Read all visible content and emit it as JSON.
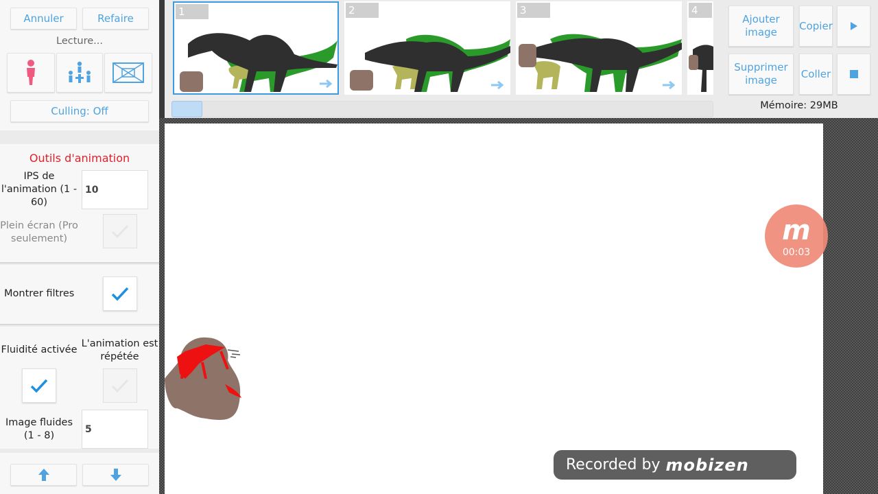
{
  "toolbar": {
    "undo_label": "Annuler",
    "redo_label": "Refaire",
    "play_label": "Lecture...",
    "culling_label": "Culling: Off"
  },
  "animation_tools": {
    "title": "Outils d'animation",
    "fps_label": "IPS de l'animation (1 - 60)",
    "fps_value": "10",
    "fullscreen_label": "Plein écran (Pro seulement)",
    "fullscreen_checked": false,
    "show_filters_label": "Montrer filtres",
    "show_filters_checked": true,
    "smoothing_label": "Fluidité activée",
    "smoothing_checked": true,
    "loop_label": "L'animation est répétée",
    "loop_checked": false,
    "smooth_frames_label": "Image fluides (1 - 8)",
    "smooth_frames_value": "5"
  },
  "frames": [
    {
      "number": "1",
      "selected": true
    },
    {
      "number": "2",
      "selected": false
    },
    {
      "number": "3",
      "selected": false
    },
    {
      "number": "4",
      "selected": false
    }
  ],
  "frame_actions": {
    "add_label": "Ajouter image",
    "copy_label": "Copier",
    "delete_label": "Supprimer image",
    "paste_label": "Coller",
    "memory_label": "Mémoire: 29MB"
  },
  "recorder": {
    "badge_letter": "m",
    "timer": "00:03",
    "recorded_by": "Recorded by",
    "brand": "mobizen"
  },
  "colors": {
    "accent": "#4ea3e0",
    "title_red": "#e0202a",
    "dino_dark": "#2f2f2f",
    "dino_green": "#2a9a2a",
    "creature_brown": "#8e7468",
    "blood_red": "#ee1111"
  }
}
